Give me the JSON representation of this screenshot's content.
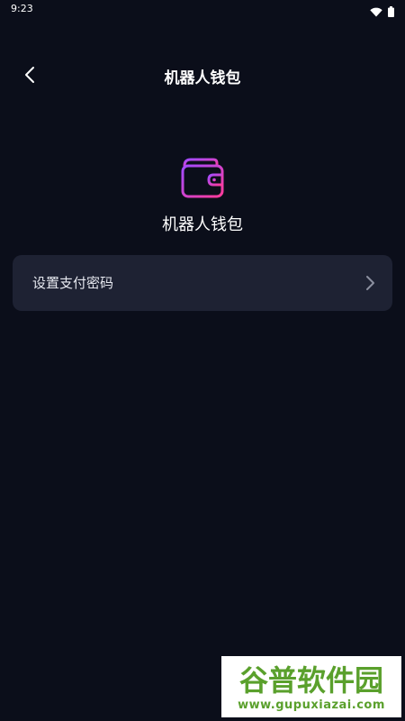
{
  "status_bar": {
    "time": "9:23",
    "icons": [
      "wifi-icon",
      "battery-icon"
    ]
  },
  "header": {
    "back_icon": "chevron-left-icon",
    "title": "机器人钱包"
  },
  "wallet": {
    "icon": "wallet-icon",
    "label": "机器人钱包"
  },
  "settings": {
    "items": [
      {
        "label": "设置支付密码",
        "icon": "chevron-right-icon"
      }
    ]
  },
  "watermark": {
    "logo_text": "谷普软件园",
    "url": "www.gupuxiazai.com",
    "color": "#5aa02c"
  },
  "colors": {
    "background": "#0b0e1a",
    "card": "#1e2233",
    "accent_start": "#c03bff",
    "accent_end": "#ff3b9a"
  }
}
